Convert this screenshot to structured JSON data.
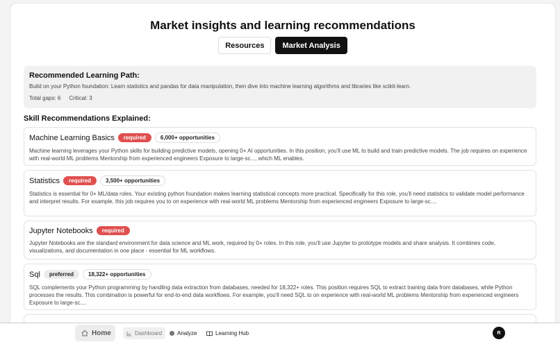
{
  "header": {
    "title": "Market insights and learning recommendations",
    "tabs": [
      {
        "label": "Resources",
        "active": false
      },
      {
        "label": "Market Analysis",
        "active": true
      }
    ]
  },
  "learning_path": {
    "title": "Recommended Learning Path:",
    "description": "Build on your Python foundation: Learn statistics and pandas for data manipulation, then dive into machine learning algorithms and libraries like scikit-learn.",
    "total_gaps": "Total gaps: 6",
    "critical": "Critical: 3"
  },
  "skills_section": {
    "title": "Skill Recommendations Explained:",
    "skills": [
      {
        "name": "Machine Learning Basics",
        "priority": "required",
        "opportunities": "6,000+ opportunities",
        "description": "Machine learning leverages your Python skills for building predictive models, opening 0+ AI opportunities. In this position, you'll use ML to build and train predictive models. The job requires on experience with real-world ML problems Mentorship from experienced engineers Exposure to large-sc..., which ML enables."
      },
      {
        "name": "Statistics",
        "priority": "required",
        "opportunities": "3,500+ opportunities",
        "description": "Statistics is essential for 0+ ML/data roles. Your existing python foundation makes learning statistical concepts more practical. Specifically for this role, you'll need statistics to validate model performance and interpret results. For example, this job requires you to on experience with real-world ML problems Mentorship from experienced engineers Exposure to large-sc...."
      },
      {
        "name": "Jupyter Notebooks",
        "priority": "required",
        "opportunities": "",
        "description": "Jupyter Notebooks are the standard environment for data science and ML work, required by 0+ roles. In this role, you'll use Jupyter to prototype models and share analysis. It combines code, visualizations, and documentation in one place - essential for ML workflows."
      },
      {
        "name": "Sql",
        "priority": "preferred",
        "opportunities": "18,322+ opportunities",
        "description": "SQL complements your Python programming by handling data extraction from databases, needed for 18,322+ roles. This position requires SQL to extract training data from databases, while Python processes the results. This combination is powerful for end-to-end data workflows. For example, you'll need SQL to on experience with real-world ML problems Mentorship from experienced engineers Exposure to large-sc...."
      }
    ]
  },
  "bottom_nav": {
    "home": "Home",
    "dashboard": "Dashboard",
    "analyze": "Analyze",
    "learning_hub": "Learning Hub",
    "avatar_initial": "R"
  }
}
